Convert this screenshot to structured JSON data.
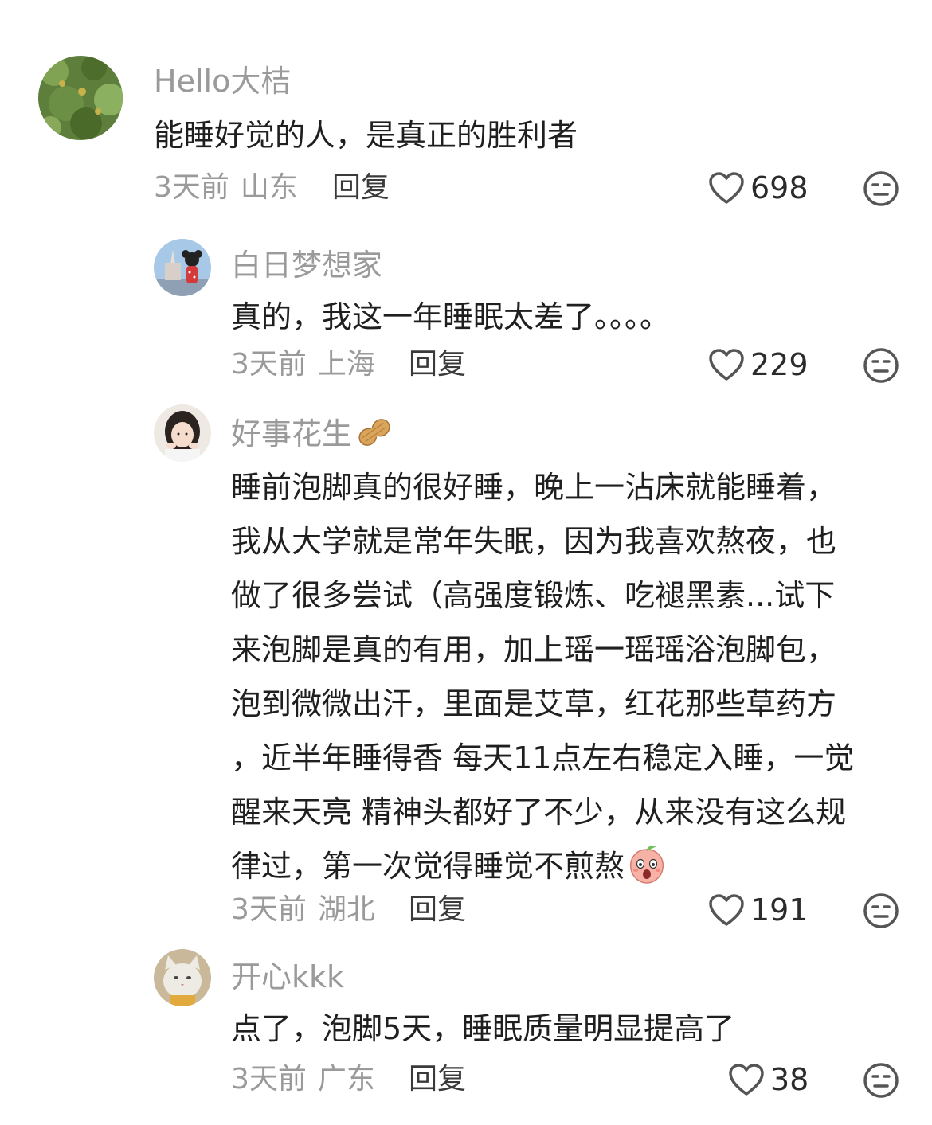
{
  "comments": [
    {
      "username": "Hello大桔",
      "text_lines": [
        "能睡好觉的人，是真正的胜利者"
      ],
      "time": "3天前",
      "location": "山东",
      "reply_label": "回复",
      "likes": "698",
      "like_icon": "heart-outline-icon",
      "dislike_icon": "meh-face-icon"
    },
    {
      "username": "白日梦想家",
      "text_lines": [
        "真的，我这一年睡眠太差了。。。。"
      ],
      "time": "3天前",
      "location": "上海",
      "reply_label": "回复",
      "likes": "229",
      "like_icon": "heart-outline-icon",
      "dislike_icon": "meh-face-icon"
    },
    {
      "username": "好事花生",
      "username_emoji": "🥜",
      "text_lines": [
        "睡前泡脚真的很好睡，晚上一沾床就能睡着，",
        "我从大学就是常年失眠，因为我喜欢熬夜，也",
        "做了很多尝试（高强度锻炼、吃褪黑素...试下",
        "来泡脚是真的有用，加上瑶一瑶瑶浴泡脚包，",
        "泡到微微出汗，里面是艾草，红花那些草药方",
        "，近半年睡得香 每天11点左右稳定入睡，一觉",
        "醒来天亮 精神头都好了不少，从来没有这么规",
        "律过，第一次觉得睡觉不煎熬"
      ],
      "time": "3天前",
      "location": "湖北",
      "reply_label": "回复",
      "likes": "191",
      "like_icon": "heart-outline-icon",
      "dislike_icon": "meh-face-icon",
      "inline_sticker": "shocked-peach-sticker"
    },
    {
      "username": "开心kkk",
      "text_lines": [
        "点了，泡脚5天，睡眠质量明显提高了"
      ],
      "time": "3天前",
      "location": "广东",
      "reply_label": "回复",
      "likes": "38",
      "like_icon": "heart-outline-icon",
      "dislike_icon": "meh-face-icon"
    }
  ],
  "colors": {
    "username": "#9a9a9a",
    "text": "#1f1f1f",
    "meta": "#9a9a9a",
    "reply": "#3a3a3a",
    "icon_stroke": "#555555"
  }
}
